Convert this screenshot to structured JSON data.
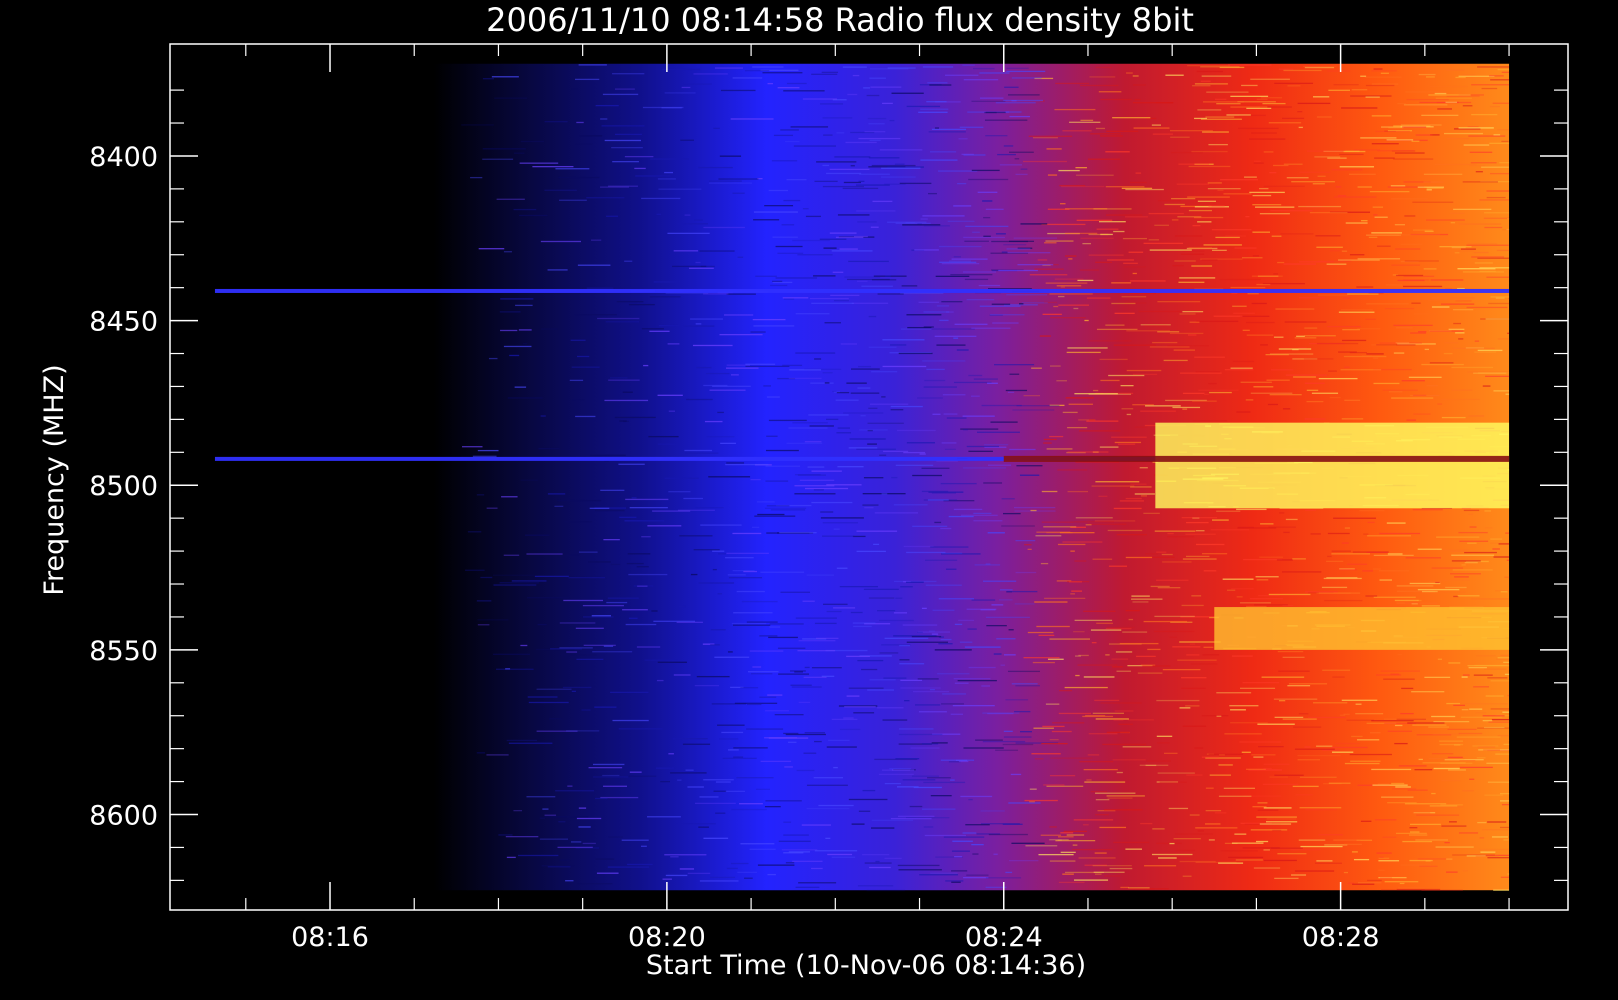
{
  "chart_data": {
    "type": "heatmap",
    "title": "2006/11/10 08:14:58 Radio flux density 8bit",
    "xlabel": "Start Time (10-Nov-06 08:14:36)",
    "ylabel": "Frequency (MHZ)",
    "x_ticks": [
      "08:16",
      "08:20",
      "08:24",
      "08:28"
    ],
    "x_tick_minutes": [
      16,
      20,
      24,
      28
    ],
    "xlim_minutes": [
      14.1,
      30.7
    ],
    "data_x_range_minutes": [
      14.8,
      30.0
    ],
    "y_ticks": [
      "8400",
      "8450",
      "8500",
      "8550",
      "8600"
    ],
    "y_tick_values": [
      8400,
      8450,
      8500,
      8550,
      8600
    ],
    "ylim_mhz": [
      8366,
      8629
    ],
    "data_y_range_mhz": [
      8372,
      8623
    ],
    "y_inverted": true,
    "colormap": [
      "#000000",
      "#2020ff",
      "#7a1fa0",
      "#d01818",
      "#ff6a10",
      "#ffd030",
      "#ffff60"
    ],
    "intensity_trend": "increases with time from black (08:15) through blue (08:20) and red (08:25) to orange-yellow (08:30)",
    "features": [
      {
        "kind": "horizontal-line",
        "frequency_mhz": 8441,
        "color": "#3030ff"
      },
      {
        "kind": "horizontal-line",
        "frequency_mhz": 8492,
        "color": "#3030ff"
      },
      {
        "kind": "bright-band",
        "frequency_range_mhz": [
          8481,
          8507
        ],
        "from_minute": 25.8,
        "color": "#ffff60"
      },
      {
        "kind": "bright-band",
        "frequency_range_mhz": [
          8537,
          8550
        ],
        "from_minute": 26.5,
        "color": "#ffc030"
      }
    ],
    "grid": false
  }
}
